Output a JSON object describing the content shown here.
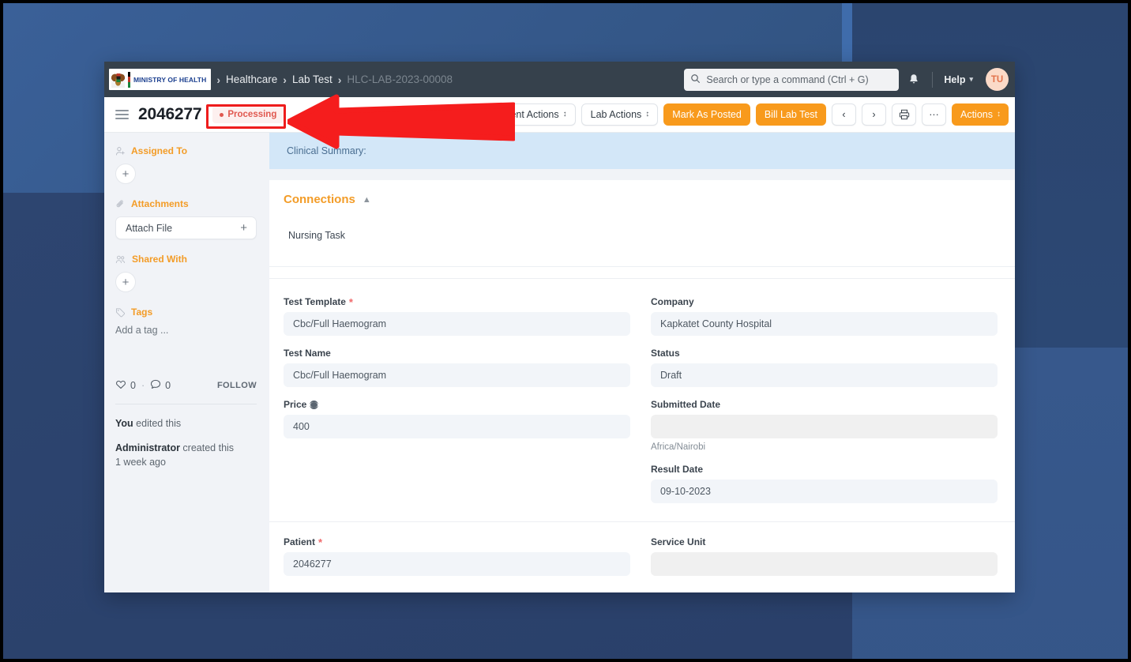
{
  "navbar": {
    "logo_text": "MINISTRY OF HEALTH",
    "breadcrumbs": [
      {
        "label": "Healthcare",
        "muted": false
      },
      {
        "label": "Lab Test",
        "muted": false
      },
      {
        "label": "HLC-LAB-2023-00008",
        "muted": true
      }
    ],
    "search_placeholder": "Search or type a command (Ctrl + G)",
    "search_value": "",
    "help_label": "Help",
    "avatar_initials": "TU"
  },
  "toolbar": {
    "doc_title": "2046277",
    "status_label": "Processing",
    "buttons": [
      {
        "label": "Payment Actions",
        "style": "light",
        "stack": true
      },
      {
        "label": "Lab Actions",
        "style": "light",
        "stack": true
      },
      {
        "label": "Mark As Posted",
        "style": "primary",
        "stack": false
      },
      {
        "label": "Bill Lab Test",
        "style": "primary",
        "stack": false
      }
    ],
    "prev_label": "‹",
    "next_label": "›",
    "more_label": "···",
    "actions_label": "Actions"
  },
  "sidebar": {
    "assigned_to_label": "Assigned To",
    "assigned_add_label": "+",
    "attachments_label": "Attachments",
    "attach_file_label": "Attach File",
    "attach_plus_label": "+",
    "shared_with_label": "Shared With",
    "shared_add_label": "+",
    "tags_label": "Tags",
    "add_tag_label": "Add a tag ...",
    "like_count": "0",
    "comment_count": "0",
    "separator": "·",
    "follow_label": "FOLLOW",
    "activity": [
      {
        "actor": "You",
        "text": " edited this",
        "time": ""
      },
      {
        "actor": "Administrator",
        "text": " created this",
        "time": "1 week ago"
      }
    ]
  },
  "main": {
    "clinical_summary_label": "Clinical Summary:",
    "connections_title": "Connections",
    "connections_item": "Nursing Task",
    "fields_left": [
      {
        "label": "Test Template",
        "required": true,
        "value": "Cbc/Full Haemogram",
        "hint": "",
        "globe": false,
        "empty": false
      },
      {
        "label": "Test Name",
        "required": false,
        "value": "Cbc/Full Haemogram",
        "hint": "",
        "globe": false,
        "empty": false
      },
      {
        "label": "Price",
        "required": false,
        "value": "400",
        "hint": "",
        "globe": true,
        "empty": false
      }
    ],
    "fields_right": [
      {
        "label": "Company",
        "required": false,
        "value": "Kapkatet County Hospital",
        "hint": "",
        "globe": false,
        "empty": false
      },
      {
        "label": "Status",
        "required": false,
        "value": "Draft",
        "hint": "",
        "globe": false,
        "empty": false
      },
      {
        "label": "Submitted Date",
        "required": false,
        "value": "",
        "hint": "Africa/Nairobi",
        "globe": false,
        "empty": true
      },
      {
        "label": "Result Date",
        "required": false,
        "value": "09-10-2023",
        "hint": "",
        "globe": false,
        "empty": false
      }
    ],
    "bottom_left": {
      "label": "Patient",
      "required": true,
      "value": "2046277",
      "empty": false
    },
    "bottom_right": {
      "label": "Service Unit",
      "required": false,
      "value": "",
      "empty": true
    }
  },
  "annotations": {
    "highlight_color": "#ee1c1c",
    "arrow_color": "#f51d1d",
    "arrow_direction": "left"
  }
}
